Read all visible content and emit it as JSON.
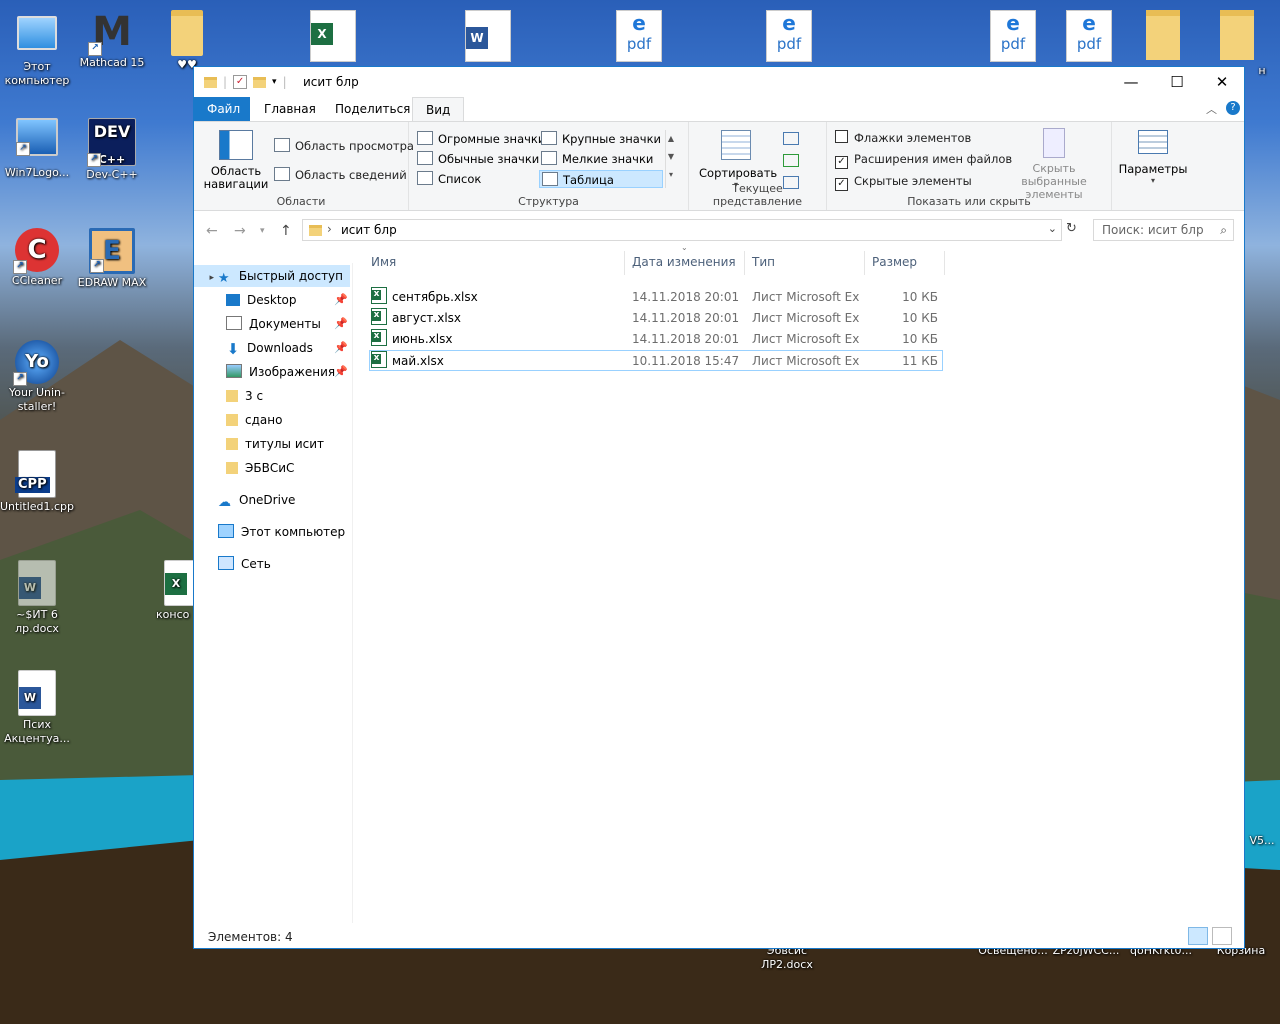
{
  "desktop": {
    "icons": [
      {
        "label": "Этот компьютер"
      },
      {
        "label": "Mathcad 15"
      },
      {
        "label": "♥♥"
      },
      {
        "label": "Win7Logo..."
      },
      {
        "label": "Dev-C++"
      },
      {
        "label": "CCleaner"
      },
      {
        "label": "EDRAW MAX"
      },
      {
        "label": "Your Unin-staller!"
      },
      {
        "label": "Untitled1.cpp"
      },
      {
        "label": "~$ИТ 6 лр.docx"
      },
      {
        "label": "консо"
      },
      {
        "label": "Псих Акцентуа..."
      },
      {
        "label": "Эбвсис ЛР2.docx"
      },
      {
        "label": "Освещено..."
      },
      {
        "label": "ZPz0jWCC..."
      },
      {
        "label": "qoHKrkt0..."
      },
      {
        "label": "Корзина"
      },
      {
        "label": "V5..."
      },
      {
        "label": "н"
      }
    ],
    "pdf_label": "pdf"
  },
  "window": {
    "title": "исит блр",
    "controls": {
      "minimize": "—",
      "maximize": "☐",
      "close": "✕"
    },
    "tabs": [
      "Файл",
      "Главная",
      "Поделиться",
      "Вид"
    ],
    "ribbon": {
      "areas": {
        "nav_pane": "Область навигации",
        "preview": "Область просмотра",
        "details": "Область сведений",
        "label": "Области"
      },
      "layout": {
        "options": [
          "Огромные значки",
          "Крупные значки",
          "Обычные значки",
          "Мелкие значки",
          "Список",
          "Таблица"
        ],
        "selected": "Таблица",
        "label": "Структура"
      },
      "current_view": {
        "sort": "Сортировать",
        "label": "Текущее представление"
      },
      "show_hide": {
        "item_checkboxes": "Флажки элементов",
        "item_checkboxes_checked": false,
        "file_extensions": "Расширения имен файлов",
        "file_extensions_checked": true,
        "hidden_items": "Скрытые элементы",
        "hidden_items_checked": true,
        "hide_selected": "Скрыть выбранные элементы",
        "label": "Показать или скрыть"
      },
      "options": "Параметры"
    },
    "address": {
      "path": "исит блр",
      "search_placeholder": "Поиск: исит блр"
    },
    "nav": {
      "quick_access": "Быстрый доступ",
      "items": [
        {
          "label": "Desktop",
          "pinned": true
        },
        {
          "label": "Документы",
          "pinned": true
        },
        {
          "label": "Downloads",
          "pinned": true
        },
        {
          "label": "Изображения",
          "pinned": true
        },
        {
          "label": "3 с",
          "pinned": false
        },
        {
          "label": "сдано",
          "pinned": false
        },
        {
          "label": "титулы исит",
          "pinned": false
        },
        {
          "label": "ЭБВСиС",
          "pinned": false
        }
      ],
      "onedrive": "OneDrive",
      "this_pc": "Этот компьютер",
      "network": "Сеть"
    },
    "columns": [
      "Имя",
      "Дата изменения",
      "Тип",
      "Размер"
    ],
    "files": [
      {
        "name": "сентябрь.xlsx",
        "date": "14.11.2018 20:01",
        "type": "Лист Microsoft Ex",
        "size": "10 КБ"
      },
      {
        "name": "август.xlsx",
        "date": "14.11.2018 20:01",
        "type": "Лист Microsoft Ex",
        "size": "10 КБ"
      },
      {
        "name": "июнь.xlsx",
        "date": "14.11.2018 20:01",
        "type": "Лист Microsoft Ex",
        "size": "10 КБ"
      },
      {
        "name": "май.xlsx",
        "date": "10.11.2018 15:47",
        "type": "Лист Microsoft Ex",
        "size": "11 КБ"
      }
    ],
    "status": "Элементов: 4"
  }
}
